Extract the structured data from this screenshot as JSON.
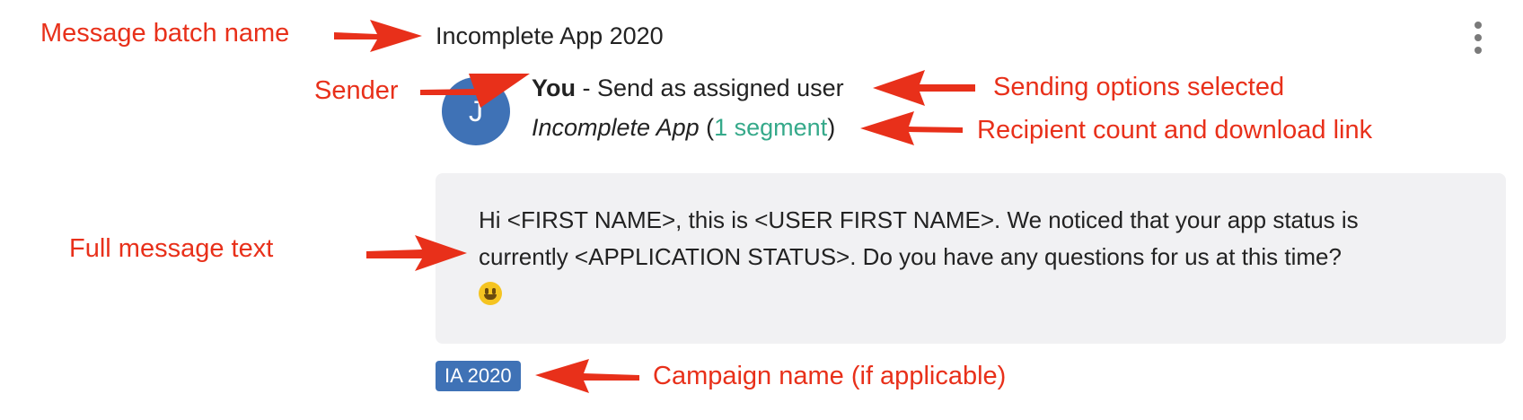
{
  "batch": {
    "title": "Incomplete App 2020",
    "menu_icon": "more-vertical-icon"
  },
  "sender": {
    "avatar_initial": "J",
    "name": "You",
    "option": " - Send as assigned user"
  },
  "recipients": {
    "list_name": "Incomplete App",
    "open_paren": " (",
    "segment_link": "1 segment",
    "close_paren": ")"
  },
  "message": {
    "line1": "Hi <FIRST NAME>, this is <USER FIRST NAME>. We noticed that your app status is",
    "line2": "currently <APPLICATION STATUS>. Do you have any questions for us at this time?",
    "emoji": "smiley-emoji-icon"
  },
  "campaign": {
    "tag": "IA 2020"
  },
  "annotations": {
    "batch_name": "Message batch name",
    "sender": "Sender",
    "sending_options": "Sending options selected",
    "recipient_count": "Recipient count and download link",
    "message_text": "Full message text",
    "campaign_name": "Campaign name (if applicable)"
  },
  "colors": {
    "annotation": "#e8301a",
    "accent_blue": "#3f72b6",
    "link_green": "#35a98a",
    "message_bg": "#f1f1f3"
  }
}
